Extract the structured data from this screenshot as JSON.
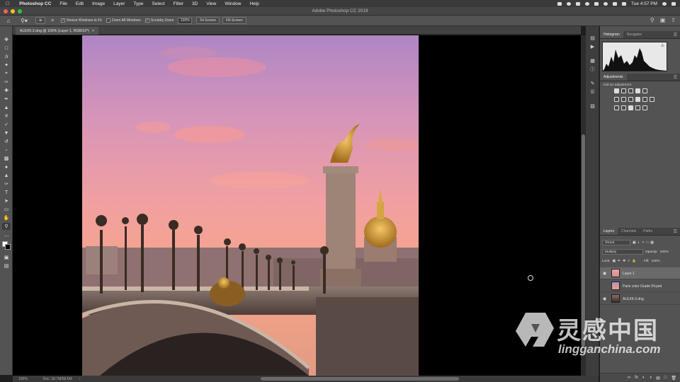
{
  "menubar": {
    "app_name": "Photoshop CC",
    "items": [
      "File",
      "Edit",
      "Image",
      "Layer",
      "Type",
      "Select",
      "Filter",
      "3D",
      "View",
      "Window",
      "Help"
    ],
    "clock": "Tue 4:57 PM"
  },
  "window": {
    "title": "Adobe Photoshop CC 2019"
  },
  "options": {
    "resize_windows_label": "Resize Windows to Fit",
    "zoom_all_windows_label": "Zoom All Windows",
    "scrubby_zoom_label": "Scrubby Zoom",
    "zoom_value": "100%",
    "fit_screen_label": "Fit Screen",
    "fill_screen_label": "Fill Screen"
  },
  "document": {
    "tab_label": "ALEX6-2.dng @ 100% (Layer 1, RGB/16*)",
    "tab_close": "×"
  },
  "status": {
    "zoom": "100%",
    "doc_info": "Doc: 30.7M/58.6M"
  },
  "panels": {
    "histogram_tab": "Histogram",
    "navigator_tab": "Navigator",
    "adjustments_tab": "Adjustments",
    "add_adjustment": "Add an adjustment",
    "layers_tab": "Layers",
    "channels_tab": "Channels",
    "paths_tab": "Paths",
    "kind_label": "Kind",
    "blend_mode": "Multiply",
    "opacity_label": "Opacity:",
    "opacity_value": "100%",
    "lock_label": "Lock:",
    "fill_label": "Fill:",
    "fill_value": "100%",
    "layers": [
      {
        "name": "Layer 1"
      },
      {
        "name": "Paris color Grade 04.psd"
      },
      {
        "name": "ALEX6-2.dng"
      }
    ]
  },
  "watermark": {
    "brand_cn": "灵感中国",
    "brand_url": "lingganchina.com"
  },
  "colors": {
    "accent": "#535353",
    "sky_top": "#b98bc4",
    "sky_bottom": "#f0a17f"
  }
}
